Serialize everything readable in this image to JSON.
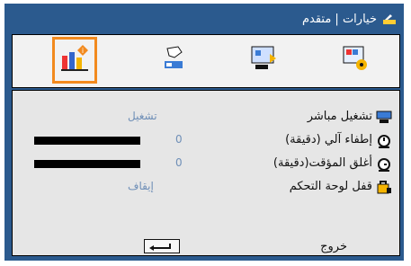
{
  "window": {
    "title": "خيارات | متقدم",
    "title_icon": "projector-icon"
  },
  "tabs": [
    {
      "name": "information-tab",
      "icon": "bar-chart-info-icon",
      "selected": true
    },
    {
      "name": "setup-tab",
      "icon": "hand-projector-icon",
      "selected": false
    },
    {
      "name": "display-tab",
      "icon": "screen-projector-icon",
      "selected": false
    },
    {
      "name": "image-tab",
      "icon": "image-settings-icon",
      "selected": false
    }
  ],
  "rows": [
    {
      "label": "تشغيل مباشر",
      "value": "تشغيل",
      "icon": "direct-power-icon"
    },
    {
      "label": "إطفاء آلي (دقيقة)",
      "value": "0",
      "icon": "auto-power-off-icon"
    },
    {
      "label": "أغلق المؤقت(دقيقة)",
      "value": "0",
      "icon": "sleep-timer-icon"
    },
    {
      "label": "قفل لوحة التحكم",
      "value": "إيقاف",
      "icon": "keypad-lock-icon"
    }
  ],
  "footer": {
    "exit_label": "خروج",
    "enter_icon": "enter-icon"
  },
  "colors": {
    "frame": "#2b5a8e",
    "panel": "#e6e6e6",
    "selected": "#f28a1e",
    "value": "#6f8fb7"
  }
}
